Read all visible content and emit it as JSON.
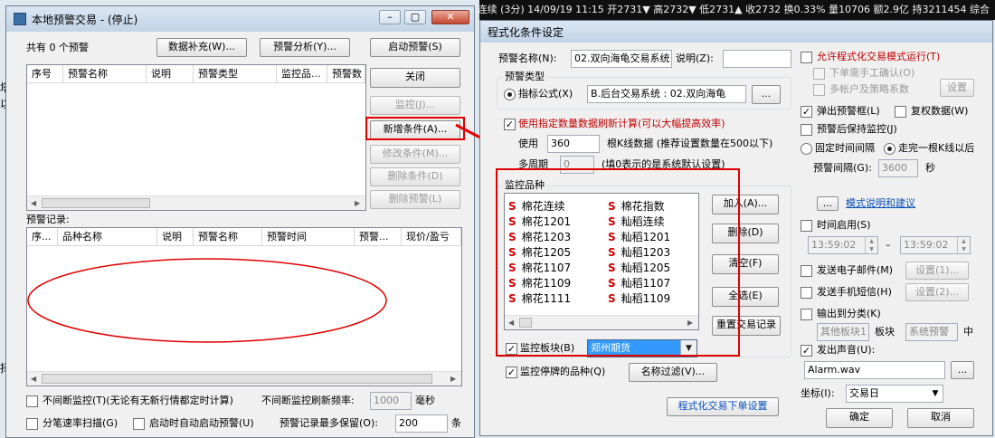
{
  "ticker": {
    "text": "XXX连续 (3分) 14/09/19 11:15 开2731▼ 高2732▼ 低2731▲ 收2732 换0.33% 量10706 额2.9亿 持3211454 综合"
  },
  "bg_text": {
    "left_a": "塔",
    "left_b": "以",
    "left_c": "择"
  },
  "main_window": {
    "title": "本地预警交易 - (停止)",
    "count_label": "共有 0 个预警",
    "data_fill_button": "数据补充(W)...",
    "alert_analysis_button": "预警分析(Y)...",
    "start_alert_button": "启动预警(S)",
    "close_button": "关闭",
    "monitor_button": "监控(J)...",
    "new_condition_button": "新增条件(A)...",
    "modify_condition_button": "修改条件(M)...",
    "delete_condition_button": "删除条件(D)",
    "delete_alert_button": "删除预警(L)",
    "alert_table_columns": [
      "序号",
      "预警名称",
      "说明",
      "预警类型",
      "监控品...",
      "预警数"
    ],
    "records_label": "预警记录:",
    "record_table_columns": [
      "序...",
      "品种名称",
      "说明",
      "预警名称",
      "预警时间",
      "预警...",
      "现价/盈亏"
    ],
    "continuous_monitor_label": "不间断监控(T)(无论有无新行情都定时计算)",
    "refresh_label": "不间断监控刷新频率:",
    "refresh_value": "1000",
    "refresh_unit": "毫秒",
    "tick_scan_label": "分笔速率扫描(G)",
    "auto_start_label": "启动时自动启动预警(U)",
    "max_records_label": "预警记录最多保留(O):",
    "max_records_value": "200",
    "max_records_unit": "条"
  },
  "dialog": {
    "title": "程式化条件设定",
    "alert_name_label": "预警名称(N):",
    "alert_name_value": "02.双向海龟交易系统",
    "desc_label": "说明(Z):",
    "desc_value": "",
    "alert_type_group": "预警类型",
    "indicator_formula_label": "指标公式(X)",
    "formula_value": "B.后台交易系统 : 02.双向海龟",
    "formula_browse": "...",
    "use_data_label": "使用指定数量数据刷新计算(可以大幅提高效率)",
    "use_label": "使用",
    "use_value": "360",
    "kline_label": "根K线数据 (推荐设置数量在500以下)",
    "multi_period_label": "多周期",
    "multi_period_value": "0",
    "multi_period_note": "(填0表示的是系统默认设置)",
    "monitor_group": "监控品种",
    "items_left": [
      "棉花连续",
      "棉花1201",
      "棉花1203",
      "棉花1205",
      "棉花1107",
      "棉花1109",
      "棉花1111"
    ],
    "items_right": [
      "棉花指数",
      "籼稻连续",
      "籼稻1201",
      "籼稻1203",
      "籼稻1205",
      "籼稻1107",
      "籼稻1109"
    ],
    "item_prefix": "S",
    "add_button": "加入(A)...",
    "delete_button": "删除(D)",
    "clear_button": "清空(F)",
    "select_all_button": "全选(E)",
    "reset_records_button": "重置交易记录",
    "monitor_sector_label": "监控板块(B)",
    "monitor_sector_value": "郑州期货",
    "monitor_suspended_label": "监控停牌的品种(Q)",
    "name_filter_button": "名称过滤(V)...",
    "order_settings_button": "程式化交易下单设置",
    "allow_auto_label": "允许程式化交易模式运行(T)",
    "manual_confirm_label": "下单需手工确认(O)",
    "multi_account_label": "多帐户及策略系数",
    "settings_button": "设置",
    "popup_label": "弹出预警框(L)",
    "restore_data_label": "复权数据(W)",
    "keep_monitor_label": "预警后保持监控(J)",
    "fixed_interval_label": "固定时间间隔",
    "after_kline_label": "走完一根K线以后",
    "interval_label": "预警间隔(G):",
    "interval_value": "3600",
    "interval_unit": "秒",
    "mode_browse": "...",
    "mode_help_link": "模式说明和建议",
    "time_enable_label": "时间启用(S)",
    "time_start": "13:59:02",
    "time_sep": "–",
    "time_end": "13:59:02",
    "send_email_label": "发送电子邮件(M)",
    "email_settings_button": "设置(1)...",
    "send_sms_label": "发送手机短信(H)",
    "sms_settings_button": "设置(2)...",
    "output_category_label": "输出到分类(K)",
    "category_a": "其他板块1",
    "category_mid": "板块",
    "category_b": "系统预警",
    "category_suffix": "中",
    "sound_label": "发出声音(U):",
    "sound_file": "Alarm.wav",
    "sound_browse": "...",
    "coord_label": "坐标(I):",
    "coord_value": "交易日",
    "ok_button": "确定",
    "cancel_button": "取消"
  },
  "colors": {
    "annotation_red": "#e00000",
    "link_blue": "#0a4fb8",
    "select_blue": "#3399ff"
  }
}
